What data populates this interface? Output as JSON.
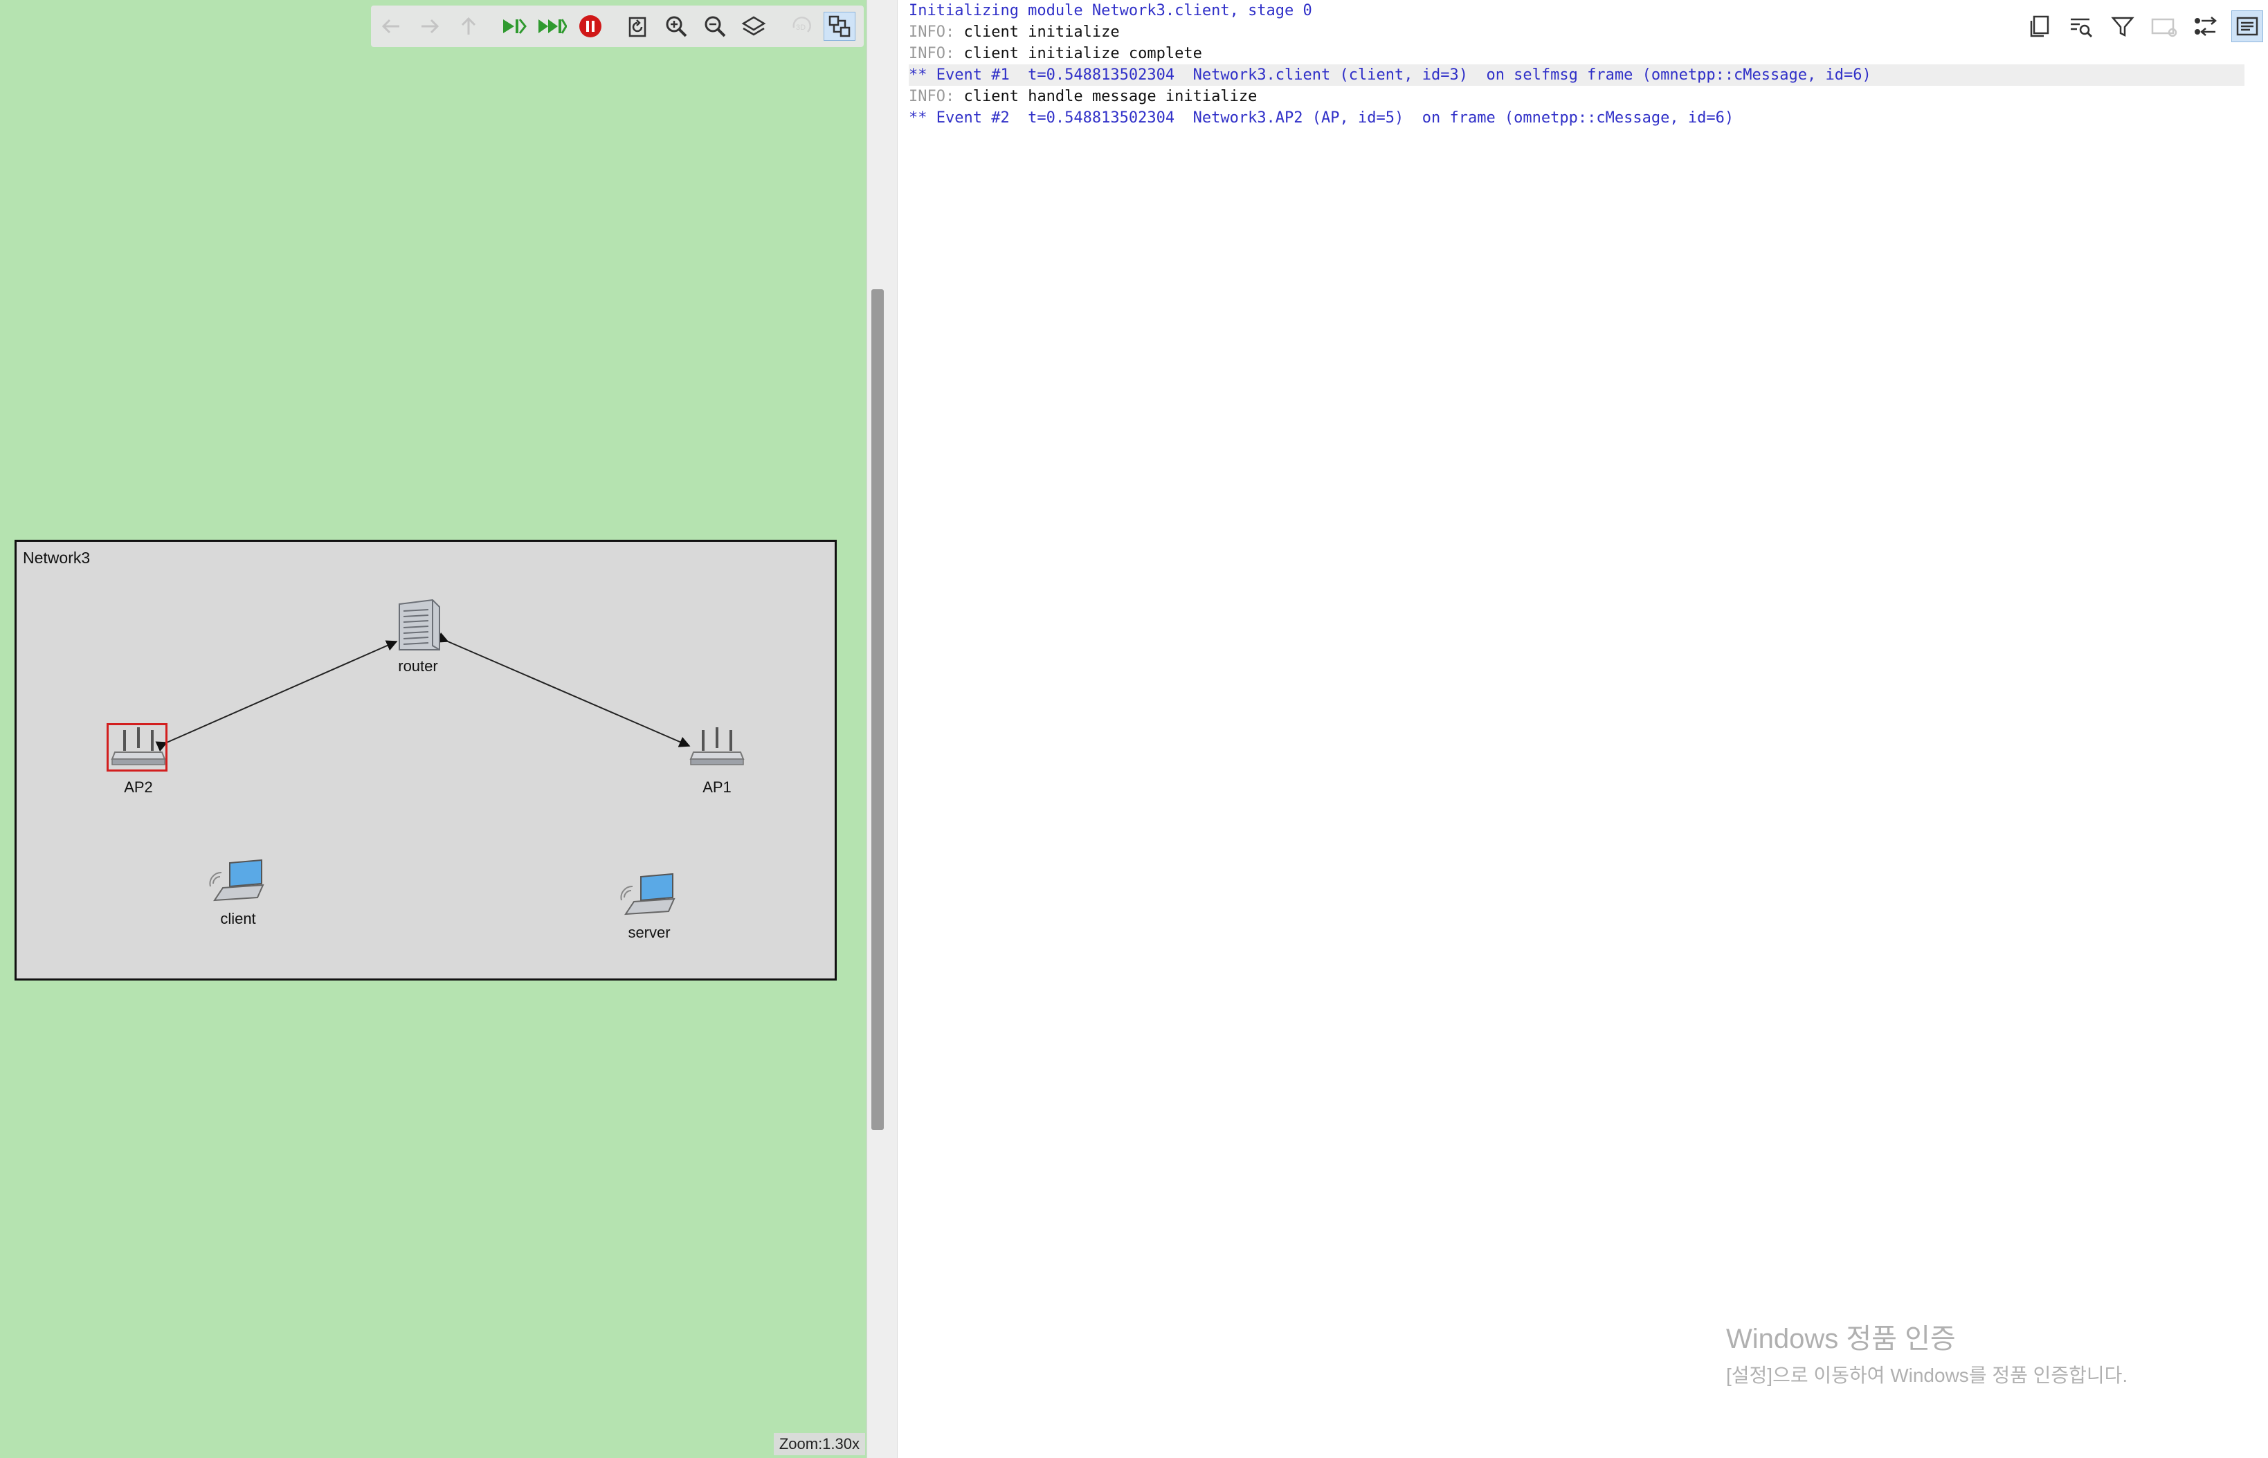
{
  "canvas": {
    "zoom_label": "Zoom:1.30x",
    "background_color": "#b5e3b0",
    "toolbar": [
      {
        "name": "back-icon",
        "enabled": false
      },
      {
        "name": "forward-icon",
        "enabled": false
      },
      {
        "name": "up-icon",
        "enabled": false
      },
      {
        "name": "step-icon",
        "enabled": true
      },
      {
        "name": "fast-run-icon",
        "enabled": true
      },
      {
        "name": "stop-icon",
        "enabled": true
      },
      {
        "name": "refresh-layout-icon",
        "enabled": true
      },
      {
        "name": "zoom-in-icon",
        "enabled": true
      },
      {
        "name": "zoom-out-icon",
        "enabled": true
      },
      {
        "name": "layers-icon",
        "enabled": true
      },
      {
        "name": "3d-icon",
        "enabled": false
      },
      {
        "name": "canvas-mode-icon",
        "enabled": true
      }
    ]
  },
  "network": {
    "title": "Network3",
    "nodes": {
      "router": {
        "label": "router",
        "icon": "server-rack-icon"
      },
      "ap2": {
        "label": "AP2",
        "icon": "access-point-icon",
        "selected": true
      },
      "ap1": {
        "label": "AP1",
        "icon": "access-point-icon"
      },
      "client": {
        "label": "client",
        "icon": "laptop-icon"
      },
      "server": {
        "label": "server",
        "icon": "laptop-icon"
      }
    },
    "links": [
      [
        "router",
        "ap2"
      ],
      [
        "router",
        "ap1"
      ]
    ]
  },
  "log": {
    "lines": [
      {
        "kind": "init",
        "text": "Initializing module Network3.client, stage 0"
      },
      {
        "kind": "info",
        "tag": "INFO:",
        "text": " client initialize"
      },
      {
        "kind": "info",
        "tag": "INFO:",
        "text": " client initialize complete"
      },
      {
        "kind": "event",
        "text": "** Event #1  t=0.548813502304  Network3.client (client, id=3)  on selfmsg frame (omnetpp::cMessage, id=6)"
      },
      {
        "kind": "info",
        "tag": "INFO:",
        "text": " client handle message initialize"
      },
      {
        "kind": "event2",
        "text": "** Event #2  t=0.548813502304  Network3.AP2 (AP, id=5)  on frame (omnetpp::cMessage, id=6)"
      }
    ],
    "toolbar": [
      "copy-icon",
      "find-icon",
      "filter-icon",
      "settings-icon",
      "message-view-icon",
      "log-view-icon"
    ]
  },
  "watermark": {
    "title": "Windows 정품 인증",
    "subtitle": "[설정]으로 이동하여 Windows를 정품 인증합니다."
  }
}
